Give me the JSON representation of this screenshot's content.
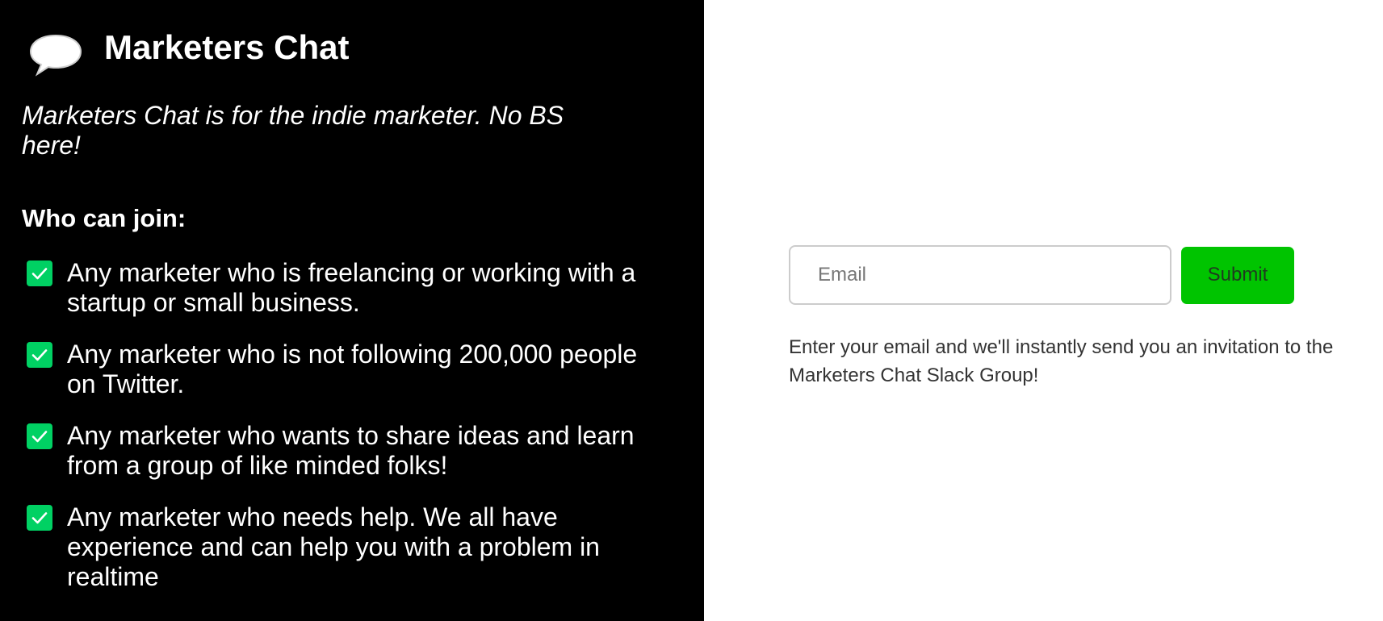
{
  "brand": {
    "title": "Marketers Chat",
    "icon": "speech-bubble-icon"
  },
  "tagline": "Marketers Chat is for the indie marketer. No BS here!",
  "who_can_join": {
    "heading": "Who can join:",
    "check_icon": "checkmark-icon",
    "items": [
      {
        "label": "Any marketer who is freelancing or working with a startup or small business."
      },
      {
        "label": "Any marketer who is not following 200,000 people on Twitter."
      },
      {
        "label": "Any marketer who wants to share ideas and learn from a group of like minded folks!"
      },
      {
        "label": "Any marketer who needs help. We all have experience and can help you with a problem in realtime"
      }
    ]
  },
  "signup": {
    "email_placeholder": "Email",
    "email_value": "",
    "submit_label": "Submit",
    "help_text": "Enter your email and we'll instantly send you an invitation to the Marketers Chat Slack Group!"
  },
  "colors": {
    "left_background": "#000000",
    "check_green": "#00d163",
    "submit_green": "#00c400"
  }
}
